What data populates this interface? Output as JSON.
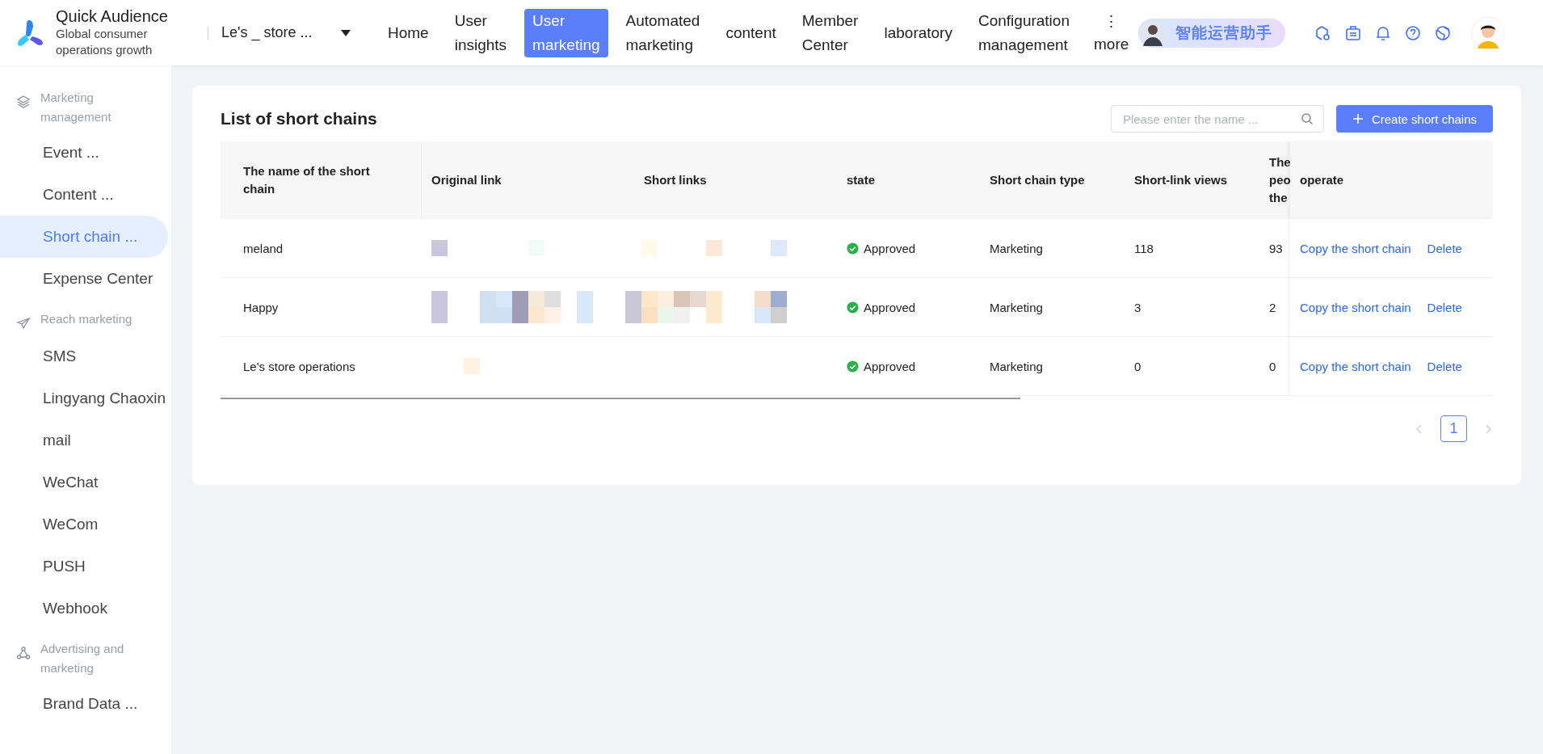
{
  "brand": {
    "title": "Quick Audience",
    "subtitle": "Global consumer operations growth"
  },
  "store_select": {
    "value": "Le's _ store ..."
  },
  "nav": [
    {
      "label": "Home",
      "selected": false
    },
    {
      "label": "User insights",
      "selected": false
    },
    {
      "label": "User marketing",
      "selected": true
    },
    {
      "label": "Automated marketing",
      "selected": false
    },
    {
      "label": "content",
      "selected": false
    },
    {
      "label": "Member Center",
      "selected": false
    },
    {
      "label": "laboratory",
      "selected": false
    },
    {
      "label": "Configuration management",
      "selected": false
    }
  ],
  "more": {
    "icon": "⋮",
    "label": "more"
  },
  "assistant": {
    "label": "智能运营助手"
  },
  "sidebar": [
    {
      "label": "Marketing management",
      "kind": "layers",
      "items": [
        {
          "label": "Event ...",
          "selected": false
        },
        {
          "label": "Content ...",
          "selected": false
        },
        {
          "label": "Short chain ...",
          "selected": true
        },
        {
          "label": "Expense Center",
          "selected": false
        }
      ]
    },
    {
      "label": "Reach marketing",
      "kind": "send",
      "items": [
        {
          "label": "SMS",
          "selected": false
        },
        {
          "label": "Lingyang Chaoxin",
          "selected": false
        },
        {
          "label": "mail",
          "selected": false
        },
        {
          "label": "WeChat",
          "selected": false
        },
        {
          "label": "WeCom",
          "selected": false
        },
        {
          "label": "PUSH",
          "selected": false
        },
        {
          "label": "Webhook",
          "selected": false
        }
      ]
    },
    {
      "label": "Advertising and marketing",
      "kind": "nodes",
      "items": [
        {
          "label": "Brand Data ...",
          "selected": false
        }
      ]
    }
  ],
  "panel": {
    "title": "List of short chains",
    "search": {
      "placeholder": "Please enter the name ..."
    },
    "create_button": "Create short chains"
  },
  "table": {
    "columns": [
      "The name of the short chain",
      "Original link",
      "Short links",
      "state",
      "Short chain type",
      "Short-link views",
      "The peo the",
      "operate"
    ],
    "rows": [
      {
        "name": "meland",
        "state": "Approved",
        "type": "Marketing",
        "views": "118",
        "people": "93",
        "actions": [
          "Copy the short chain",
          "Delete"
        ]
      },
      {
        "name": "Happy",
        "state": "Approved",
        "type": "Marketing",
        "views": "3",
        "people": "2",
        "actions": [
          "Copy the short chain",
          "Delete"
        ]
      },
      {
        "name": "Le's store operations",
        "state": "Approved",
        "type": "Marketing",
        "views": "0",
        "people": "0",
        "actions": [
          "Copy the short chain",
          "Delete"
        ]
      }
    ]
  },
  "pagination": {
    "pages": [
      {
        "label": "1",
        "selected": true
      }
    ]
  }
}
